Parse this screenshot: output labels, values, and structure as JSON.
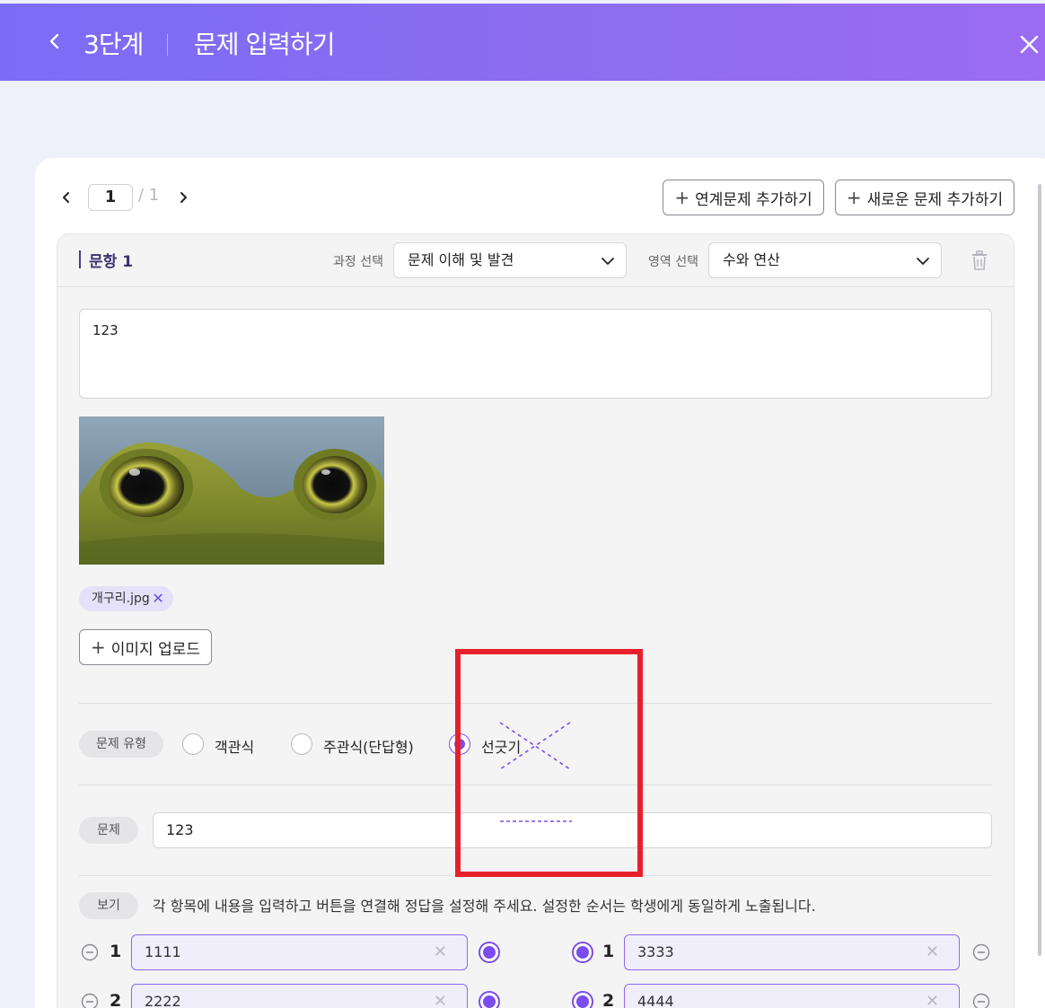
{
  "header": {
    "step": "3단계",
    "title": "문제 입력하기"
  },
  "pager": {
    "current": "1",
    "total": "/ 1"
  },
  "toolbar": {
    "add_linked_label": "연계문제 추가하기",
    "add_new_label": "새로운 문제 추가하기"
  },
  "question": {
    "label": "문항 1",
    "course_label": "과정 선택",
    "course_value": "문제 이해 및 발견",
    "area_label": "영역 선택",
    "area_value": "수와 연산",
    "body_text": "123"
  },
  "attachment": {
    "file_name": "개구리.jpg",
    "upload_label": "이미지 업로드"
  },
  "type_section": {
    "label": "문제 유형",
    "options": [
      {
        "label": "객관식",
        "selected": false
      },
      {
        "label": "주관식(단답형)",
        "selected": false
      },
      {
        "label": "선긋기",
        "selected": true
      }
    ]
  },
  "problem_section": {
    "label": "문제",
    "value": "123"
  },
  "example_section": {
    "label": "보기",
    "hint": "각 항목에 내용을 입력하고 버튼을 연결해 정답을 설정해 주세요. 설정한 순서는 학생에게 동일하게 노출됩니다.",
    "left_items": [
      {
        "num": "1",
        "value": "1111"
      },
      {
        "num": "2",
        "value": "2222"
      }
    ],
    "right_items": [
      {
        "num": "1",
        "value": "3333"
      },
      {
        "num": "2",
        "value": "4444"
      }
    ]
  },
  "colors": {
    "accent": "#7b4dee",
    "header_start": "#7b6cf6",
    "header_end": "#9b6cf0",
    "annotation": "#e8202b"
  }
}
